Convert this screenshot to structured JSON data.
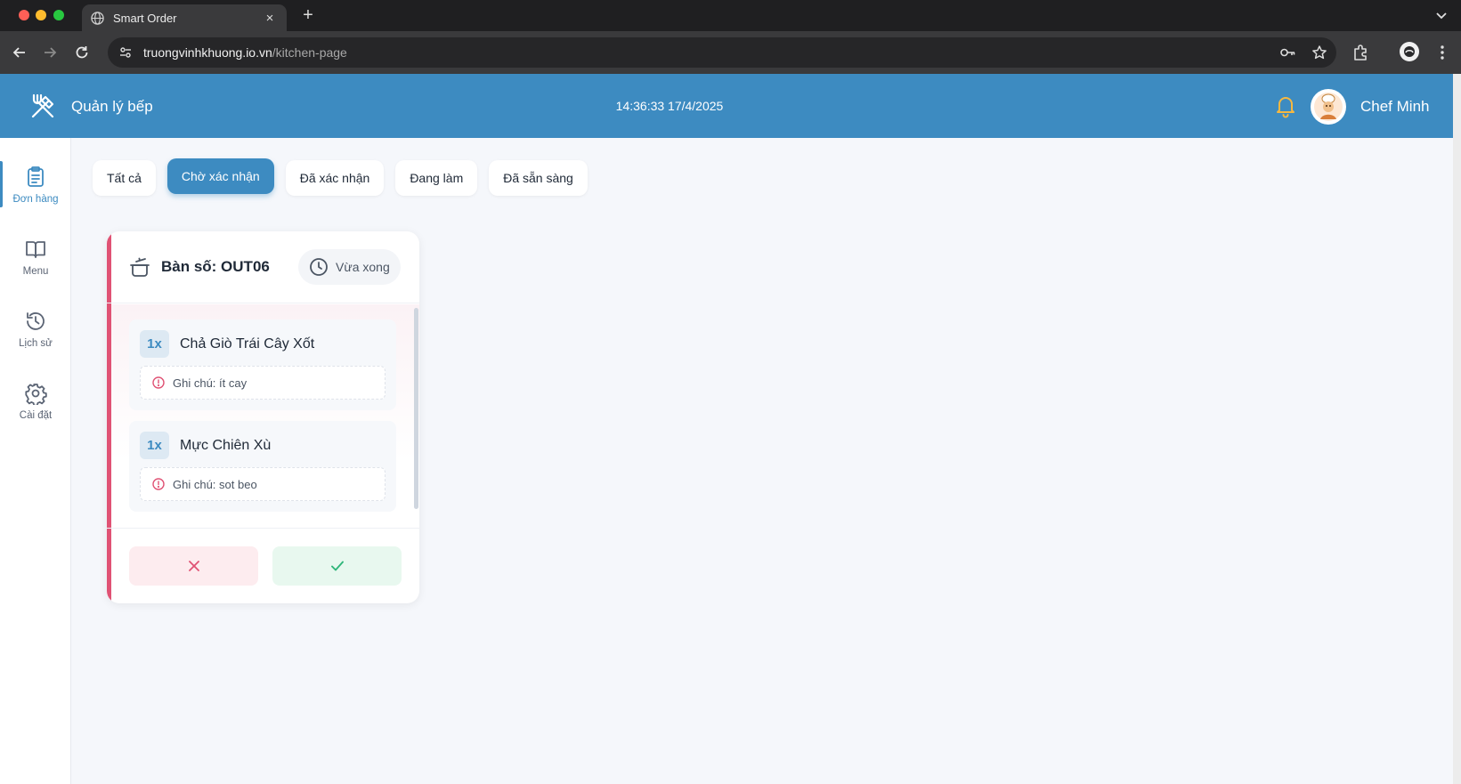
{
  "browser": {
    "tab_title": "Smart Order",
    "tab_close": "×",
    "new_tab": "+",
    "url_host": "truongvinhkhuong.io.vn",
    "url_path": "/kitchen-page"
  },
  "header": {
    "title": "Quản lý bếp",
    "datetime": "14:36:33 17/4/2025",
    "user_name": "Chef Minh"
  },
  "sidebar": {
    "items": [
      {
        "label": "Đơn hàng",
        "icon": "clipboard-icon",
        "active": true
      },
      {
        "label": "Menu",
        "icon": "book-icon",
        "active": false
      },
      {
        "label": "Lịch sử",
        "icon": "history-icon",
        "active": false
      },
      {
        "label": "Cài đặt",
        "icon": "gear-icon",
        "active": false
      }
    ]
  },
  "filters": [
    {
      "label": "Tất cả",
      "active": false
    },
    {
      "label": "Chờ xác nhận",
      "active": true
    },
    {
      "label": "Đã xác nhận",
      "active": false
    },
    {
      "label": "Đang làm",
      "active": false
    },
    {
      "label": "Đã sẵn sàng",
      "active": false
    }
  ],
  "order": {
    "table_label": "Bàn số: OUT06",
    "time_label": "Vừa xong",
    "items": [
      {
        "qty": "1x",
        "name": "Chả Giò Trái Cây Xốt",
        "note": "Ghi chú: ít cay"
      },
      {
        "qty": "1x",
        "name": "Mực Chiên Xù",
        "note": "Ghi chú: sot beo"
      }
    ]
  },
  "colors": {
    "header_bg": "#3d8bc1",
    "accent_pending": "#e05274",
    "reject": "#e05274",
    "accept": "#2fb67a",
    "bell": "#f5b841"
  }
}
